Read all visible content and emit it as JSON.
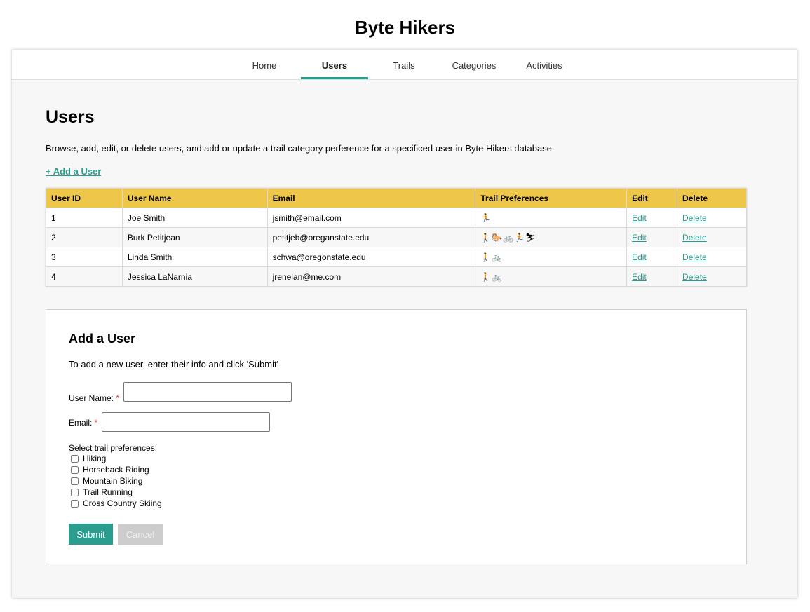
{
  "site": {
    "title": "Byte Hikers"
  },
  "nav": {
    "items": [
      {
        "label": "Home",
        "active": false
      },
      {
        "label": "Users",
        "active": true
      },
      {
        "label": "Trails",
        "active": false
      },
      {
        "label": "Categories",
        "active": false
      },
      {
        "label": "Activities",
        "active": false
      }
    ]
  },
  "page": {
    "heading": "Users",
    "description": "Browse, add, edit, or delete users, and add or update a trail category perference for a specificed user in Byte Hikers database",
    "add_link": "+ Add a User"
  },
  "table": {
    "headers": [
      "User ID",
      "User Name",
      "Email",
      "Trail Preferences",
      "Edit",
      "Delete"
    ],
    "rows": [
      {
        "id": "1",
        "name": "Joe Smith",
        "email": "jsmith@email.com",
        "prefs": "🏃",
        "edit": "Edit",
        "delete": "Delete"
      },
      {
        "id": "2",
        "name": "Burk Petitjean",
        "email": "petitjeb@oreganstate.edu",
        "prefs": "🚶🐎🚲🏃⛷",
        "edit": "Edit",
        "delete": "Delete"
      },
      {
        "id": "3",
        "name": "Linda Smith",
        "email": "schwa@oregonstate.edu",
        "prefs": "🚶🚲",
        "edit": "Edit",
        "delete": "Delete"
      },
      {
        "id": "4",
        "name": "Jessica LaNarnia",
        "email": "jrenelan@me.com",
        "prefs": "🚶🚲",
        "edit": "Edit",
        "delete": "Delete"
      }
    ]
  },
  "form": {
    "title": "Add a User",
    "description": "To add a new user, enter their info and click 'Submit'",
    "user_name_label": "User Name:",
    "email_label": "Email:",
    "required_mark": "*",
    "user_name_value": "",
    "email_value": "",
    "prefs_label": "Select trail preferences:",
    "prefs": [
      {
        "label": "Hiking",
        "checked": false
      },
      {
        "label": "Horseback Riding",
        "checked": false
      },
      {
        "label": "Mountain Biking",
        "checked": false
      },
      {
        "label": "Trail Running",
        "checked": false
      },
      {
        "label": "Cross Country Skiing",
        "checked": false
      }
    ],
    "submit_label": "Submit",
    "cancel_label": "Cancel"
  },
  "colors": {
    "accent": "#2a9d8f",
    "table_header": "#edc64a",
    "required": "#dd3333"
  }
}
